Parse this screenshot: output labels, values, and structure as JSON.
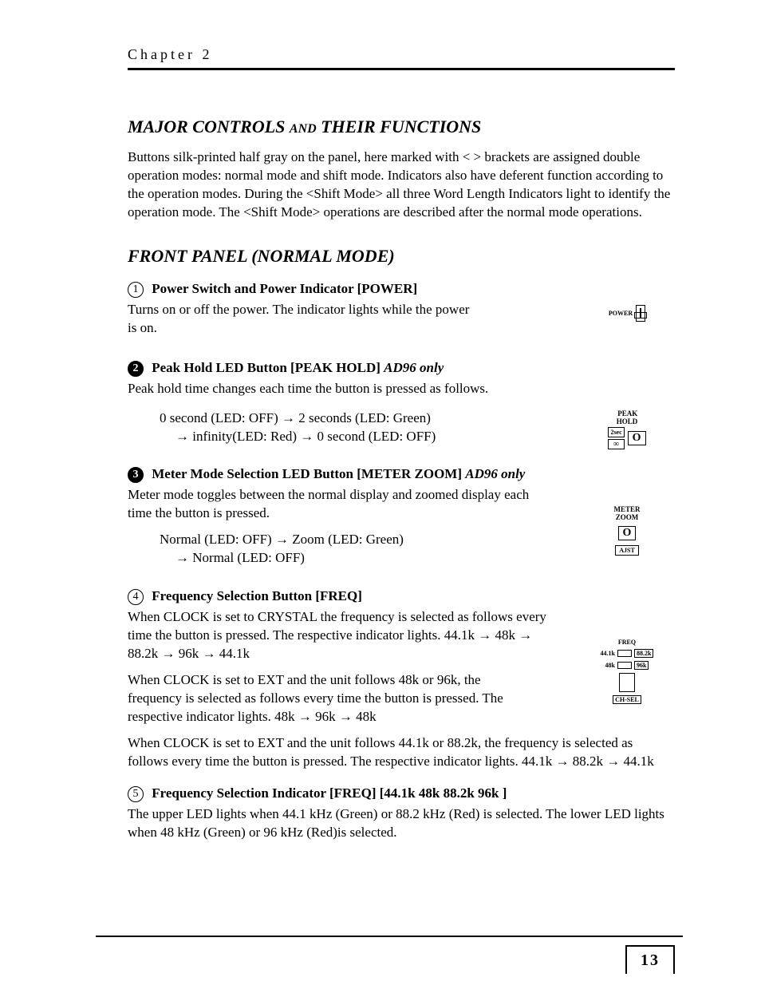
{
  "chapter": "Chapter 2",
  "heading_major": "MAJOR CONTROLS",
  "heading_and": "AND",
  "heading_their": "THEIR FUNCTIONS",
  "intro": "Buttons silk-printed half gray on the panel, here marked with < > brackets are assigned double operation modes: normal mode and shift mode. Indicators also have deferent function according to the operation modes. During the <Shift Mode> all three Word Length Indicators light to identify the operation mode. The <Shift Mode> operations are described after the normal mode operations.",
  "heading_front": "FRONT PANEL (NORMAL MODE)",
  "items": {
    "i1": {
      "num": "1",
      "title": "Power Switch and Power Indicator [POWER]",
      "body": "Turns on or off the power. The indicator lights while the power is on."
    },
    "i2": {
      "num": "2",
      "title": "Peak Hold LED Button [PEAK HOLD]",
      "tag": "AD96 only",
      "body": "Peak hold time changes each time the button is pressed as follows.",
      "line1": "0 second (LED: OFF)  →  2 seconds (LED: Green)",
      "line2": "→  infinity(LED: Red)  → 0 second (LED: OFF)"
    },
    "i3": {
      "num": "3",
      "title": "Meter Mode Selection LED Button [METER ZOOM]",
      "tag": "AD96 only",
      "body": "Meter mode toggles between the normal display and zoomed display each time the button is pressed.",
      "line1": "Normal (LED: OFF)  →  Zoom (LED: Green)",
      "line2": "→  Normal (LED: OFF)"
    },
    "i4": {
      "num": "4",
      "title": "Frequency Selection Button [FREQ]",
      "p1": "When CLOCK is set to CRYSTAL the frequency is selected as follows every time the button is pressed. The respective indicator lights.   44.1k  →  48k  →  88.2k  →  96k  →  44.1k",
      "p2": "When CLOCK is set to EXT and the unit follows 48k or 96k, the frequency is selected as follows every time the button is pressed. The respective indicator lights.   48k  →  96k  →  48k",
      "p3": "When CLOCK is set to EXT and the unit follows 44.1k or 88.2k, the frequency is selected as follows every time the button is pressed. The respective indicator lights.  44.1k  →  88.2k  →  44.1k"
    },
    "i5": {
      "num": "5",
      "title": "Frequency Selection Indicator [FREQ] [44.1k 48k 88.2k 96k ]",
      "p1": "The upper LED lights when 44.1 kHz (Green) or 88.2 kHz (Red) is selected. The lower LED lights when 48 kHz (Green) or 96 kHz (Red)is selected."
    }
  },
  "fig": {
    "power": "POWER",
    "peak_hold": "PEAK\nHOLD",
    "two_sec": "2sec",
    "inf": "∞",
    "O": "O",
    "meter_zoom": "METER\nZOOM",
    "ajst": "AJST",
    "freq": "FREQ",
    "f441": "44.1k",
    "f882": "88.2k",
    "f48": "48k",
    "f96": "96k",
    "chsel": "CH-SEL"
  },
  "page_number": "13"
}
